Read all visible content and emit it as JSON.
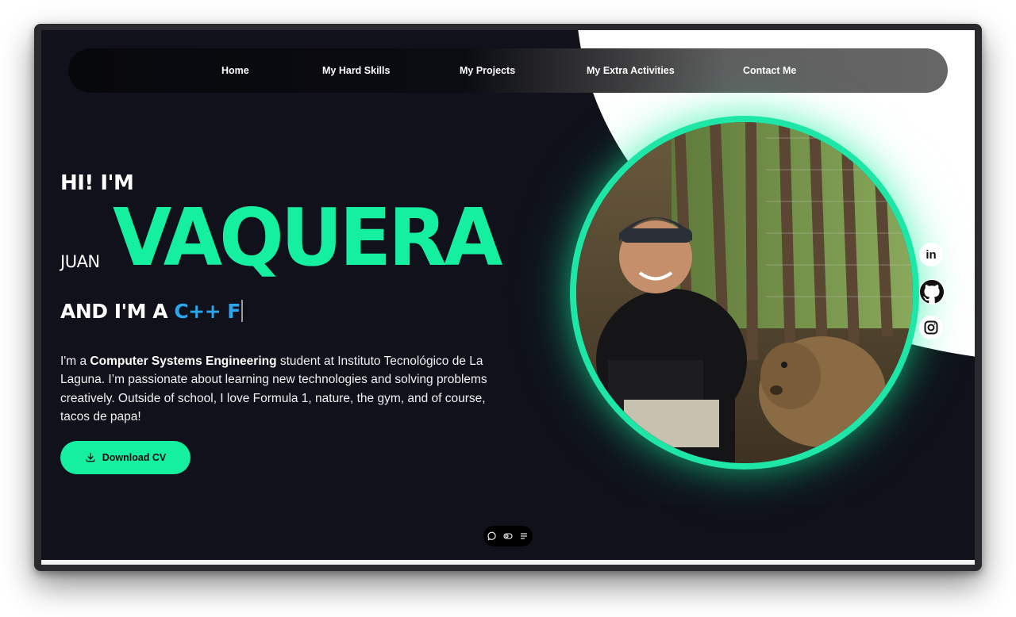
{
  "nav": {
    "items": [
      {
        "label": "Home"
      },
      {
        "label": "My Hard Skills"
      },
      {
        "label": "My Projects"
      },
      {
        "label": "My Extra Activities"
      },
      {
        "label": "Contact Me"
      }
    ]
  },
  "hero": {
    "greeting": "HI! I'M",
    "first_name": "JUAN",
    "last_name": "VAQUERA",
    "role_prefix": "AND I'M A ",
    "role_typed": "C++ F",
    "bio_start": "I'm a ",
    "bio_bold": "Computer Systems Engineering",
    "bio_rest": " student at Instituto Tecnológico de La Laguna. I’m passionate about learning new technologies and solving problems creatively. Outside of school, I love Formula 1, nature, the gym, and of course, tacos de papa!",
    "cv_button": "Download CV"
  },
  "social": [
    {
      "icon": "linkedin-icon",
      "text": "in"
    },
    {
      "icon": "github-icon"
    },
    {
      "icon": "instagram-icon"
    }
  ],
  "dock": [
    {
      "icon": "chat-icon"
    },
    {
      "icon": "toggle-icon"
    },
    {
      "icon": "list-icon"
    }
  ],
  "colors": {
    "accent": "#14f0a0",
    "typed": "#2aa6f0",
    "background": "#10111a"
  }
}
